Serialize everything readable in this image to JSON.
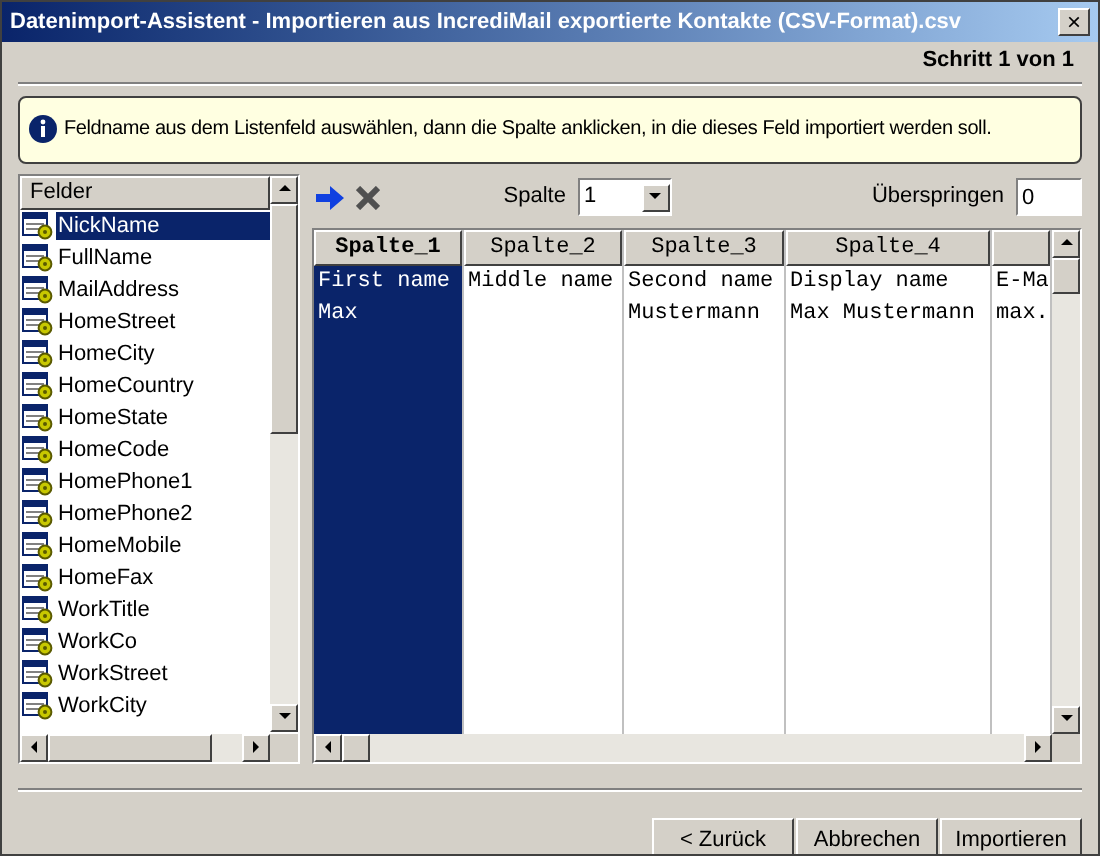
{
  "window": {
    "title": "Datenimport-Assistent - Importieren aus  IncrediMail exportierte Kontakte (CSV-Format).csv",
    "close": "×"
  },
  "step": "Schritt 1 von 1",
  "info": "Feldname aus dem Listenfeld auswählen, dann die Spalte anklicken, in die dieses Feld importiert werden soll.",
  "fields": {
    "header": "Felder",
    "items": [
      {
        "label": "NickName",
        "selected": true
      },
      {
        "label": "FullName",
        "selected": false
      },
      {
        "label": "MailAddress",
        "selected": false
      },
      {
        "label": "HomeStreet",
        "selected": false
      },
      {
        "label": "HomeCity",
        "selected": false
      },
      {
        "label": "HomeCountry",
        "selected": false
      },
      {
        "label": "HomeState",
        "selected": false
      },
      {
        "label": "HomeCode",
        "selected": false
      },
      {
        "label": "HomePhone1",
        "selected": false
      },
      {
        "label": "HomePhone2",
        "selected": false
      },
      {
        "label": "HomeMobile",
        "selected": false
      },
      {
        "label": "HomeFax",
        "selected": false
      },
      {
        "label": "WorkTitle",
        "selected": false
      },
      {
        "label": "WorkCo",
        "selected": false
      },
      {
        "label": "WorkStreet",
        "selected": false
      },
      {
        "label": "WorkCity",
        "selected": false
      }
    ]
  },
  "toolbar": {
    "column_label": "Spalte",
    "column_value": "1",
    "skip_label": "Überspringen",
    "skip_value": "0"
  },
  "grid": {
    "columns": [
      {
        "header": "Spalte_1",
        "selected": true,
        "cells": [
          "First name",
          "Max"
        ]
      },
      {
        "header": "Spalte_2",
        "selected": false,
        "cells": [
          "Middle name"
        ]
      },
      {
        "header": "Spalte_3",
        "selected": false,
        "cells": [
          "Second name",
          "Mustermann"
        ]
      },
      {
        "header": "Spalte_4",
        "selected": false,
        "cells": [
          "Display name",
          "Max Mustermann"
        ]
      },
      {
        "selected": false,
        "cells": [
          "E-Ma",
          "max."
        ]
      }
    ]
  },
  "buttons": [
    "< Zurück",
    "Abbrechen",
    "Importieren"
  ]
}
